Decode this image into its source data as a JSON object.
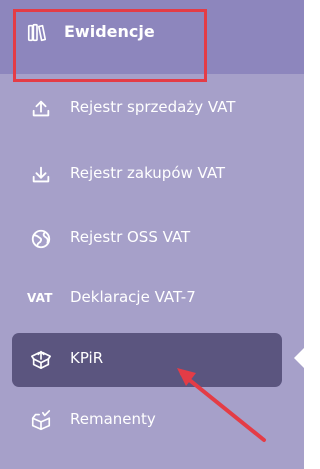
{
  "colors": {
    "sidebar_bg": "#a6a0c9",
    "header_bg": "#8d86bd",
    "active_bg": "#5b557f",
    "annotation_red": "#e43c46",
    "text": "#ffffff"
  },
  "section": {
    "title": "Ewidencje",
    "icon": "book-icon"
  },
  "nav": {
    "items": [
      {
        "label": "Rejestr sprzedaży VAT",
        "icon": "upload-icon",
        "active": false
      },
      {
        "label": "Rejestr zakupów VAT",
        "icon": "download-icon",
        "active": false
      },
      {
        "label": "Rejestr OSS VAT",
        "icon": "globe-icon",
        "active": false
      },
      {
        "label": "Deklaracje VAT-7",
        "icon": "vat-text-icon",
        "icon_text": "VAT",
        "active": false
      },
      {
        "label": "KPiR",
        "icon": "open-box-icon",
        "active": true
      },
      {
        "label": "Remanenty",
        "icon": "box-check-icon",
        "active": false
      }
    ]
  }
}
